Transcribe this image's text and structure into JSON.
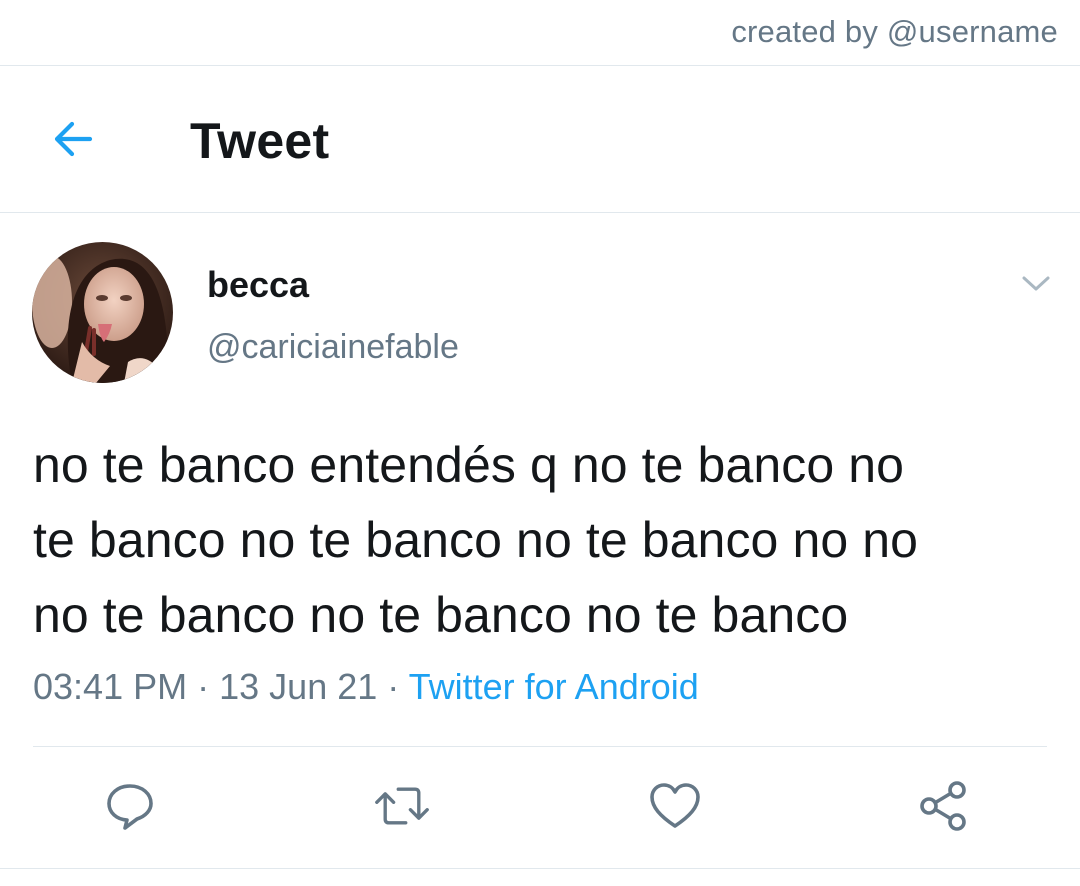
{
  "watermark": "created by @username",
  "header": {
    "title": "Tweet"
  },
  "tweet": {
    "display_name": "becca",
    "handle": "@cariciainefable",
    "lines": [
      "no te banco entendés q no te banco no",
      "te banco no te banco no te banco no no",
      "no te banco no te banco no te banco"
    ],
    "time": "03:41 PM",
    "date": "13 Jun 21",
    "separator": "·",
    "source": "Twitter for Android"
  },
  "colors": {
    "accent": "#1da1f2",
    "text_primary": "#14171a",
    "text_secondary": "#657786",
    "divider": "#e1e8ed"
  },
  "icons": {
    "back": "arrow-left-icon",
    "caret": "chevron-down-icon",
    "reply": "reply-icon",
    "retweet": "retweet-icon",
    "like": "heart-icon",
    "share": "share-icon"
  }
}
